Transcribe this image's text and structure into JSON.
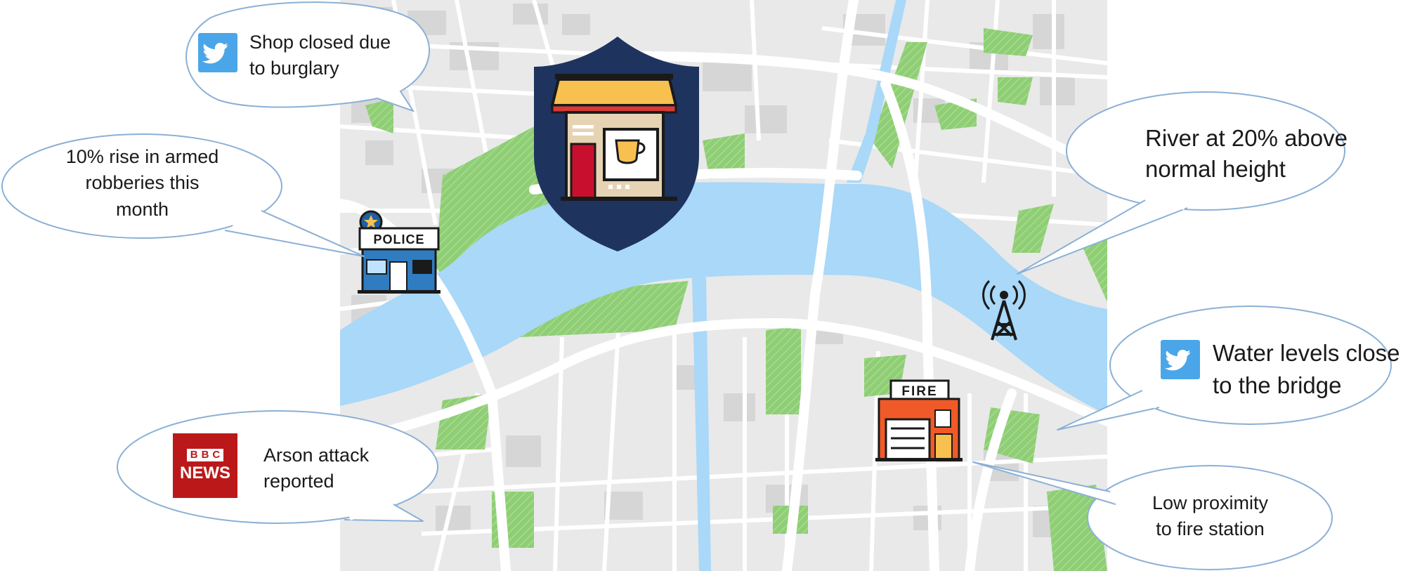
{
  "map": {
    "colors": {
      "land": "#eaeaea",
      "block": "#d8d8d8",
      "road": "#ffffff",
      "water": "#a9d8f8",
      "park": "#8fce75",
      "bubble_fill": "#ffffff",
      "bubble_stroke": "#8bb0d6"
    }
  },
  "markers": {
    "shop": {
      "icon": "shield-shop-icon",
      "shield_color": "#1f335f"
    },
    "police": {
      "icon": "police-station-icon",
      "label": "POLICE"
    },
    "tower": {
      "icon": "radio-tower-icon"
    },
    "fire": {
      "icon": "fire-station-icon",
      "label": "FIRE"
    }
  },
  "callouts": {
    "burglary": {
      "source": "twitter-icon",
      "line1": "Shop closed due",
      "line2": "to burglary"
    },
    "robbery": {
      "line1": "10% rise in armed",
      "line2": "robberies this",
      "line3": "month"
    },
    "river": {
      "line1": "River at 20% above",
      "line2": "normal height"
    },
    "water": {
      "source": "twitter-icon",
      "line1": "Water levels close",
      "line2": "to the bridge"
    },
    "arson": {
      "source": "bbc-news-logo",
      "logo_line1": "BBC",
      "logo_line2": "NEWS",
      "line1": "Arson attack",
      "line2": "reported"
    },
    "fire_proximity": {
      "line1": "Low proximity",
      "line2": "to fire station"
    }
  }
}
